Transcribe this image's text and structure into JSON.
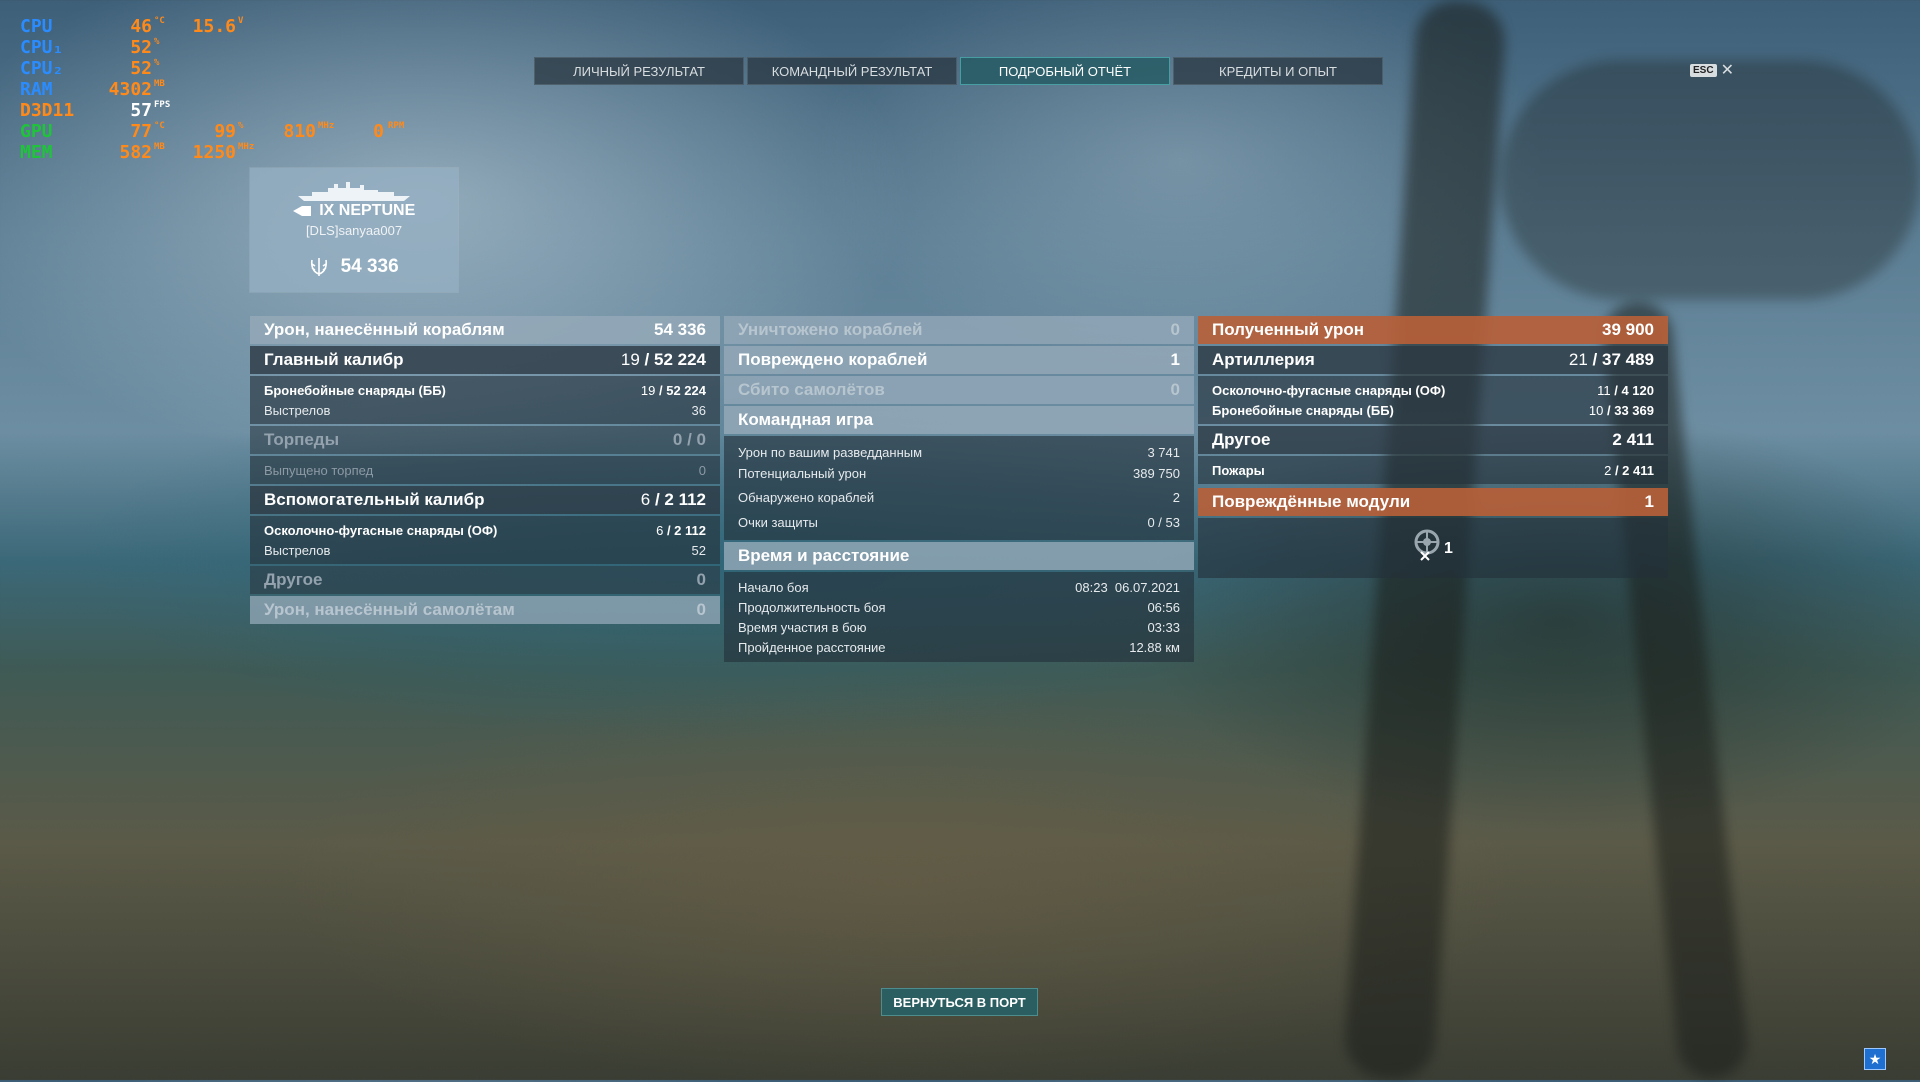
{
  "hud": {
    "cpu": {
      "label": "CPU",
      "temp": "46",
      "temp_unit": "°C",
      "volt": "15.6",
      "volt_unit": "V"
    },
    "cpu1": {
      "label": "CPU₁",
      "value": "52",
      "unit": "%"
    },
    "cpu2": {
      "label": "CPU₂",
      "value": "52",
      "unit": "%"
    },
    "ram": {
      "label": "RAM",
      "value": "4302",
      "unit": "MB"
    },
    "d3d": {
      "label": "D3D11",
      "value": "57",
      "unit": "FPS"
    },
    "gpu": {
      "label": "GPU",
      "temp": "77",
      "temp_unit": "°C",
      "load": "99",
      "load_unit": "%",
      "clock": "810",
      "clock_unit": "MHz",
      "fan": "0",
      "fan_unit": "RPM"
    },
    "mem": {
      "label": "MEM",
      "value": "582",
      "unit": "MB",
      "clock": "1250",
      "clock_unit": "MHz"
    }
  },
  "tabs": [
    "ЛИЧНЫЙ РЕЗУЛЬТАТ",
    "КОМАНДНЫЙ РЕЗУЛЬТАТ",
    "ПОДРОБНЫЙ ОТЧЁТ",
    "КРЕДИТЫ И ОПЫТ"
  ],
  "active_tab": "ПОДРОБНЫЙ ОТЧЁТ",
  "esc_key": "ESC",
  "ship": {
    "name": "IX NEPTUNE",
    "player": "[DLS]sanyaa007",
    "score": "54 336"
  },
  "left": {
    "damage": {
      "label": "Урон, нанесённый кораблям",
      "value": "54 336"
    },
    "main_battery": {
      "label": "Главный калибр",
      "hits": "19",
      "value": "52 224"
    },
    "mb_ap": {
      "label": "Бронебойные снаряды (ББ)",
      "hits": "19",
      "value": "52 224"
    },
    "mb_shots": {
      "label": "Выстрелов",
      "value": "36"
    },
    "torpedoes": {
      "label": "Торпеды",
      "value": "0 / 0"
    },
    "torp_fired": {
      "label": "Выпущено торпед",
      "value": "0"
    },
    "secondary": {
      "label": "Вспомогательный калибр",
      "hits": "6",
      "value": "2 112"
    },
    "sec_he": {
      "label": "Осколочно-фугасные снаряды (ОФ)",
      "hits": "6",
      "value": "2 112"
    },
    "sec_shots": {
      "label": "Выстрелов",
      "value": "52"
    },
    "other": {
      "label": "Другое",
      "value": "0"
    },
    "planes_damage": {
      "label": "Урон, нанесённый самолётам",
      "value": "0"
    }
  },
  "mid": {
    "destroyed": {
      "label": "Уничтожено кораблей",
      "value": "0"
    },
    "damaged": {
      "label": "Повреждено кораблей",
      "value": "1"
    },
    "planes_shot": {
      "label": "Сбито самолётов",
      "value": "0"
    },
    "team_play": {
      "label": "Командная игра"
    },
    "spot_damage": {
      "label": "Урон по вашим разведданным",
      "value": "3 741"
    },
    "potential": {
      "label": "Потенциальный урон",
      "value": "389 750"
    },
    "spotted": {
      "label": "Обнаружено кораблей",
      "value": "2"
    },
    "defense": {
      "label": "Очки защиты",
      "value": "0 / 53"
    },
    "time_dist": {
      "label": "Время и расстояние"
    },
    "battle_start": {
      "label": "Начало боя",
      "value": "08:23  06.07.2021"
    },
    "battle_duration": {
      "label": "Продолжительность боя",
      "value": "06:56"
    },
    "time_in_battle": {
      "label": "Время участия в бою",
      "value": "03:33"
    },
    "distance": {
      "label": "Пройденное расстояние",
      "value": "12.88 км"
    }
  },
  "right": {
    "received": {
      "label": "Полученный урон",
      "value": "39 900"
    },
    "artillery": {
      "label": "Артиллерия",
      "hits": "21",
      "value": "37 489"
    },
    "art_he": {
      "label": "Осколочно-фугасные снаряды (ОФ)",
      "hits": "11",
      "value": "4 120"
    },
    "art_ap": {
      "label": "Бронебойные снаряды (ББ)",
      "hits": "10",
      "value": "33 369"
    },
    "other": {
      "label": "Другое",
      "value": "2 411"
    },
    "fires": {
      "label": "Пожары",
      "hits": "2",
      "value": "2 411"
    },
    "modules": {
      "label": "Повреждённые модули",
      "value": "1"
    },
    "module_count": "1"
  },
  "return_button": "ВЕРНУТЬСЯ В ПОРТ",
  "colors": {
    "accent": "#1f6fd0",
    "header_light": "#96aab9",
    "received_orange": "#b95f37"
  }
}
